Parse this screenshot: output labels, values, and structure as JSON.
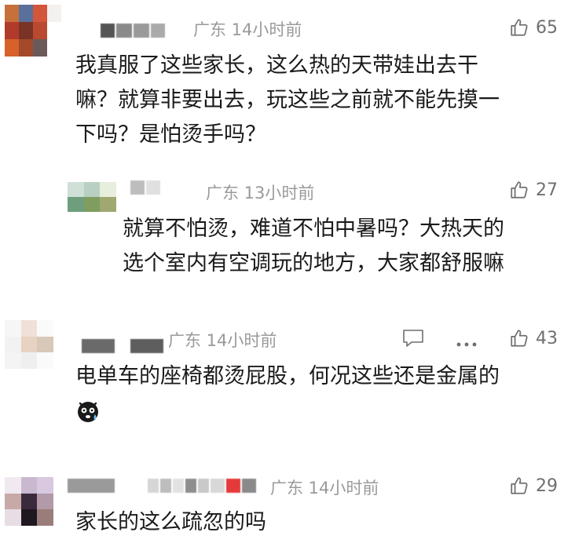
{
  "comments": [
    {
      "meta": "广东 14小时前",
      "likes": "65",
      "lines": [
        "我真服了这些家长，这么热的天带娃出去干",
        "嘛？就算非要出去，玩这些之前就不能先摸一",
        "下吗？是怕烫手吗？"
      ]
    },
    {
      "meta": "广东 13小时前",
      "likes": "27",
      "lines": [
        "就算不怕烫，难道不怕中暑吗？大热天的",
        "选个室内有空调玩的地方，大家都舒服嘛"
      ]
    },
    {
      "meta": "广东 14小时前",
      "likes": "43",
      "lines": [
        "电单车的座椅都烫屁股，何况这些还是金属的"
      ]
    },
    {
      "meta": "广东 14小时前",
      "likes": "29",
      "lines": [
        "家长的这么疏忽的吗"
      ]
    }
  ],
  "icons": {
    "like": "thumbs-up-icon",
    "reply": "comment-icon",
    "more": "more-dots-icon",
    "emoji": "sweat-face-emoji"
  },
  "colors": {
    "text": "#1a1a1a",
    "meta": "#9a9a9a",
    "icon": "#6f6f6f"
  }
}
